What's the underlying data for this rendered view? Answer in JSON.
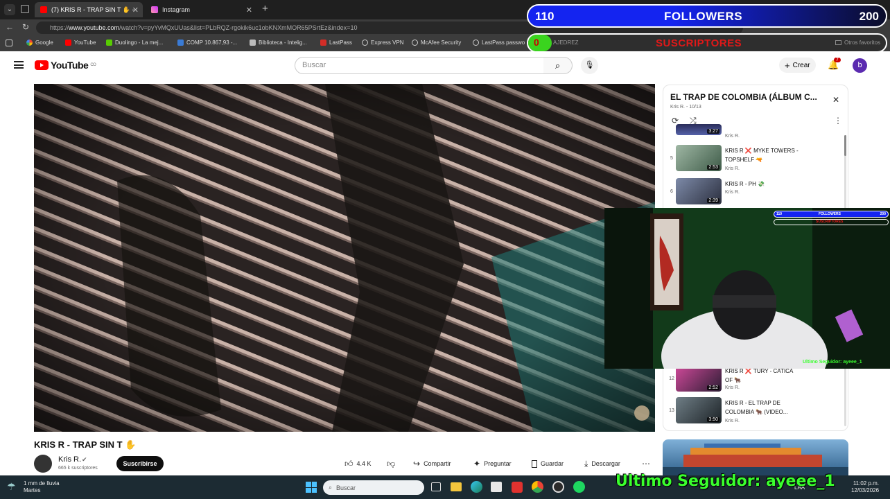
{
  "browser": {
    "tabs": [
      {
        "title": "(7) KRIS R - TRAP SIN T ✋ - YouTube",
        "active": true,
        "icon": "youtube-icon"
      },
      {
        "title": "Instagram",
        "active": false,
        "icon": "instagram-icon"
      }
    ],
    "url_prefix": "https://",
    "url_host": "www.youtube.com",
    "url_path": "/watch?v=pyYvMQxUUas&list=PLbRQZ-rgokik6uc1obKNXmMOR65PSrtEz&index=10",
    "bookmarks": [
      "Google",
      "YouTube",
      "Duolingo - La mej...",
      "COMP 10.867,93 -...",
      "Biblioteca - Intelig...",
      "LastPass",
      "Express VPN",
      "McAfee Security",
      "LastPass passwo",
      "AJEDREZ"
    ],
    "other_favorites": "Otros favoritos"
  },
  "youtube": {
    "logo": "YouTube",
    "logo_region": "CO",
    "search_placeholder": "Buscar",
    "create_label": "Crear",
    "notif_count": "7",
    "avatar_letter": "b",
    "video_title": "KRIS R - TRAP SIN T ✋",
    "channel_name": "Kris R.",
    "subscribers": "665 k suscriptores",
    "subscribe_label": "Suscribirse",
    "likes": "4.4 K",
    "share_label": "Compartir",
    "ask_label": "Preguntar",
    "save_label": "Guardar",
    "download_label": "Descargar"
  },
  "playlist": {
    "title": "EL TRAP DE COLOMBIA (ÁLBUM C...",
    "meta": "Kris R. - 10/13",
    "items": [
      {
        "num": "",
        "title": "",
        "channel": "Kris R.",
        "duration": "3:27"
      },
      {
        "num": "5",
        "title": "KRIS R ❌ MYKE TOWERS - TOPSHELF 🔫",
        "channel": "Kris R.",
        "duration": "2:53"
      },
      {
        "num": "6",
        "title": "KRIS R - PH 💸",
        "channel": "Kris R.",
        "duration": "2:39"
      },
      {
        "num": "12",
        "title": "KRIS R ❌ TURY - CATICA OF 🐂",
        "channel": "Kris R.",
        "duration": "2:52"
      },
      {
        "num": "13",
        "title": "KRIS R - EL TRAP DE COLOMBIA 🐂 (VIDEO...",
        "channel": "Kris R.",
        "duration": "3:50"
      }
    ]
  },
  "overlay": {
    "followers_current": "110",
    "followers_label": "FOLLOWERS",
    "followers_goal": "200",
    "subs_current": "0",
    "subs_label": "SUSCRIPTORES",
    "last_follower": "Ultimo Seguidor: ayeee_1",
    "last_follower_small": "Ultimo Seguidor: ayeee_1"
  },
  "taskbar": {
    "weather_line1": "1 mm de lluvia",
    "weather_line2": "Martes",
    "search_placeholder": "Buscar",
    "lang": "LAA",
    "time": "11:02 p.m.",
    "date": "12/03/2026"
  },
  "colors": {
    "youtube_red": "#ff0000",
    "overlay_blue": "#1424f0",
    "overlay_green": "#3aff2e"
  }
}
